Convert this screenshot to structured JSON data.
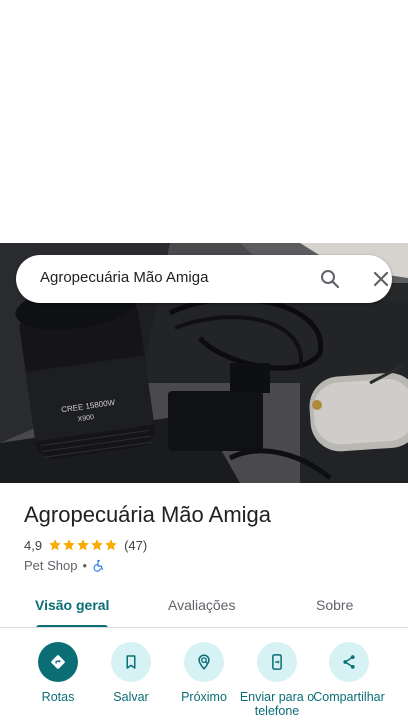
{
  "search": {
    "query": "Agropecuária Mão Amiga",
    "search_icon": "search-icon",
    "close_icon": "close-icon"
  },
  "place": {
    "name": "Agropecuária Mão Amiga",
    "rating": "4,9",
    "rating_stars": 5,
    "review_count": "(47)",
    "category": "Pet Shop",
    "separator": "•",
    "accessibility_icon": "wheelchair-icon"
  },
  "tabs": [
    {
      "label": "Visão geral",
      "active": true
    },
    {
      "label": "Avaliações",
      "active": false
    },
    {
      "label": "Sobre",
      "active": false
    }
  ],
  "actions": [
    {
      "label": "Rotas",
      "icon": "directions-icon"
    },
    {
      "label": "Salvar",
      "icon": "bookmark-icon"
    },
    {
      "label": "Próximo",
      "icon": "nearby-icon"
    },
    {
      "label": "Enviar para o telefone",
      "icon": "send-to-phone-icon"
    },
    {
      "label": "Compartilhar",
      "icon": "share-icon"
    }
  ],
  "colors": {
    "accent": "#0b6e75",
    "accent_light": "#d7f2f4",
    "star": "#f9ab00",
    "accessibility": "#1a73e8"
  }
}
